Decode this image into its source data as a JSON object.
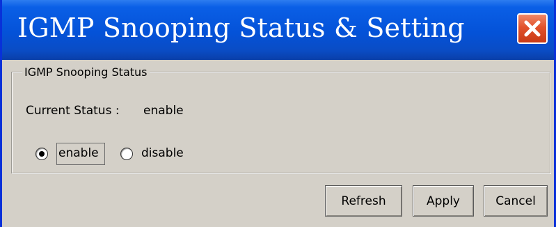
{
  "window": {
    "title": "IGMP Snooping Status & Setting",
    "titlebar_color": "#0452d8",
    "close_button_color": "#e2522c"
  },
  "status_group": {
    "legend": "IGMP Snooping Status",
    "current_status_label": "Current Status :",
    "current_status_value": "enable",
    "options": [
      {
        "label": "enable",
        "selected": true
      },
      {
        "label": "disable",
        "selected": false
      }
    ]
  },
  "buttons": {
    "refresh": "Refresh",
    "apply": "Apply",
    "cancel": "Cancel"
  },
  "icons": {
    "close": "close-icon"
  }
}
